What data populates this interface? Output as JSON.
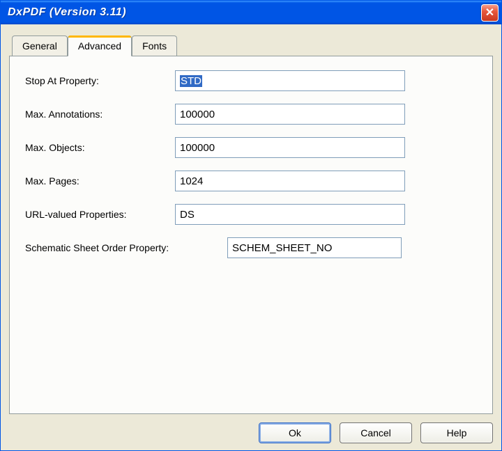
{
  "window": {
    "title": "DxPDF (Version 3.11)"
  },
  "tabs": {
    "general": "General",
    "advanced": "Advanced",
    "fonts": "Fonts"
  },
  "fields": {
    "stopAt": {
      "label": "Stop At Property:",
      "value": "STD"
    },
    "maxAnnot": {
      "label": "Max. Annotations:",
      "value": "100000"
    },
    "maxObj": {
      "label": "Max. Objects:",
      "value": "100000"
    },
    "maxPages": {
      "label": "Max. Pages:",
      "value": "1024"
    },
    "urlProps": {
      "label": "URL-valued Properties:",
      "value": "DS"
    },
    "schem": {
      "label": "Schematic Sheet Order Property:",
      "value": "SCHEM_SHEET_NO"
    }
  },
  "buttons": {
    "ok": "Ok",
    "cancel": "Cancel",
    "help": "Help"
  }
}
